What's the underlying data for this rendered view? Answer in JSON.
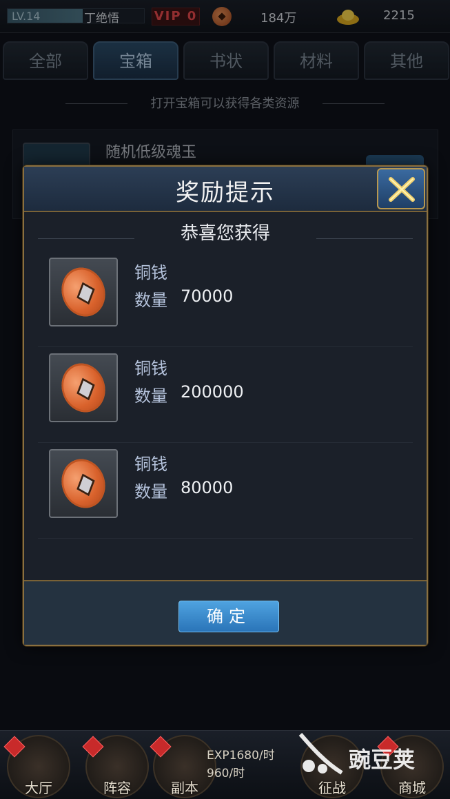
{
  "topbar": {
    "level": "LV.14",
    "level_progress": 0.55,
    "player_name": "丁绝悟",
    "vip": "VIP 0",
    "copper": "184万",
    "gold": "2215"
  },
  "tabs": [
    {
      "label": "全部",
      "active": false
    },
    {
      "label": "宝箱",
      "active": true
    },
    {
      "label": "书状",
      "active": false
    },
    {
      "label": "材料",
      "active": false
    },
    {
      "label": "其他",
      "active": false
    }
  ],
  "banner": "打开宝箱可以获得各类资源",
  "background_item": {
    "name": "随机低级魂玉"
  },
  "dialog": {
    "title": "奖励提示",
    "subtitle": "恭喜您获得",
    "qty_label": "数量",
    "rewards": [
      {
        "name": "铜钱",
        "quantity": "70000",
        "icon": "copper-coin-icon"
      },
      {
        "name": "铜钱",
        "quantity": "200000",
        "icon": "copper-coin-icon"
      },
      {
        "name": "铜钱",
        "quantity": "80000",
        "icon": "copper-coin-icon"
      }
    ],
    "confirm_label": "确定"
  },
  "bottomnav": {
    "items": [
      {
        "label": "大厅"
      },
      {
        "label": "阵容"
      },
      {
        "label": "副本"
      },
      {
        "label": "征战"
      },
      {
        "label": "商城"
      }
    ],
    "exp_rate": "EXP1680/时",
    "copper_rate": "960/时"
  },
  "watermark": "豌豆荚"
}
